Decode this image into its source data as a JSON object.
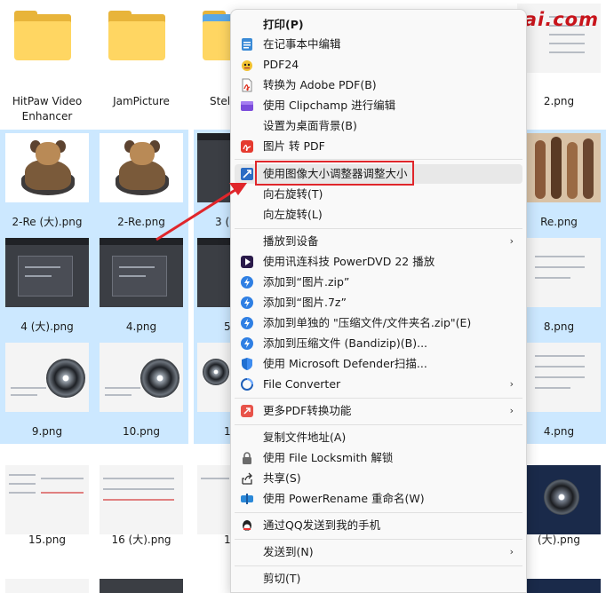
{
  "watermark": "www.dgrai.com",
  "files": [
    {
      "name": "HitPaw Video\nEnhancer"
    },
    {
      "name": "JamPicture"
    },
    {
      "name": "Stel"
    },
    {
      "name": "2.png"
    },
    {
      "name": "2-Re (大).png"
    },
    {
      "name": "2-Re.png"
    },
    {
      "name": "3 ("
    },
    {
      "name": "Re.png"
    },
    {
      "name": "4 (大).png"
    },
    {
      "name": "4.png"
    },
    {
      "name": "5"
    },
    {
      "name": "8.png"
    },
    {
      "name": "9.png"
    },
    {
      "name": "10.png"
    },
    {
      "name": "1"
    },
    {
      "name": "4.png"
    },
    {
      "name": "15.png"
    },
    {
      "name": "16 (大).png"
    },
    {
      "name": "1"
    },
    {
      "name": "(大).png"
    }
  ],
  "menu": {
    "items": [
      {
        "label": "打印(P)",
        "icon": "none-icon"
      },
      {
        "label": "在记事本中编辑",
        "icon": "notepad-icon"
      },
      {
        "label": "PDF24",
        "icon": "pdf24-icon"
      },
      {
        "label": "转换为 Adobe PDF(B)",
        "icon": "adobe-pdf-icon"
      },
      {
        "label": "使用 Clipchamp 进行编辑",
        "icon": "clipchamp-icon"
      },
      {
        "label": "设置为桌面背景(B)",
        "icon": "none-icon"
      },
      {
        "label": "图片 转 PDF",
        "icon": "image-to-pdf-icon"
      },
      {
        "label": "使用图像大小调整器调整大小",
        "icon": "image-resizer-icon"
      },
      {
        "label": "向右旋转(T)",
        "icon": "none-icon"
      },
      {
        "label": "向左旋转(L)",
        "icon": "none-icon"
      },
      {
        "label": "播放到设备",
        "icon": "none-icon"
      },
      {
        "label": "使用讯连科技 PowerDVD 22 播放",
        "icon": "powerdvd-icon"
      },
      {
        "label": "添加到“图片.zip”",
        "icon": "bandizip-icon"
      },
      {
        "label": "添加到“图片.7z”",
        "icon": "bandizip-icon"
      },
      {
        "label": "添加到单独的 \"压缩文件/文件夹名.zip\"(E)",
        "icon": "bandizip-icon"
      },
      {
        "label": "添加到压缩文件 (Bandizip)(B)...",
        "icon": "bandizip-icon"
      },
      {
        "label": "使用 Microsoft Defender扫描...",
        "icon": "defender-icon"
      },
      {
        "label": "File Converter",
        "icon": "file-converter-icon"
      },
      {
        "label": "更多PDF转换功能",
        "icon": "pdf-more-icon"
      },
      {
        "label": "复制文件地址(A)",
        "icon": "none-icon"
      },
      {
        "label": "使用 File Locksmith 解锁",
        "icon": "lock-icon"
      },
      {
        "label": "共享(S)",
        "icon": "share-icon"
      },
      {
        "label": "使用 PowerRename 重命名(W)",
        "icon": "powerrename-icon"
      },
      {
        "label": "通过QQ发送到我的手机",
        "icon": "qq-icon"
      },
      {
        "label": "发送到(N)",
        "icon": "none-icon"
      },
      {
        "label": "剪切(T)",
        "icon": "none-icon"
      }
    ],
    "submenu_arrow": "›"
  },
  "colors": {
    "selection": "#cce8ff",
    "highlight_border": "#e0262b",
    "watermark": "#c8141b",
    "arrow": "#e0262b"
  }
}
